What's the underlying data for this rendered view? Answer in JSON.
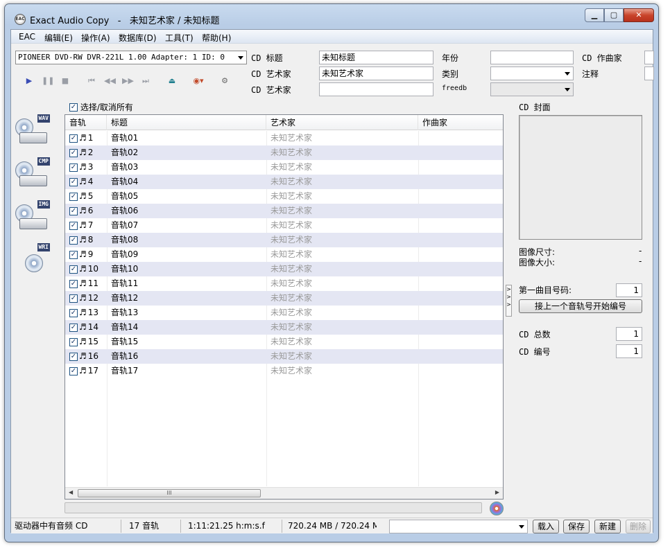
{
  "window": {
    "app_name": "Exact Audio Copy",
    "separator": "-",
    "doc_title": "未知艺术家 / 未知标题"
  },
  "menu": [
    "EAC",
    "编辑(E)",
    "操作(A)",
    "数据库(D)",
    "工具(T)",
    "帮助(H)"
  ],
  "drive": {
    "selected": "PIONEER DVD-RW  DVR-221L 1.00  Adapter: 1  ID: 0"
  },
  "metadata": {
    "cd_title_label": "CD 标题",
    "cd_title_value": "未知标题",
    "cd_artist_label": "CD 艺术家",
    "cd_artist_value": "未知艺术家",
    "cd_artist2_label": "CD 艺术家",
    "cd_artist2_value": "",
    "year_label": "年份",
    "year_value": "",
    "genre_label": "类别",
    "freedb_label": "freedb",
    "composer_label": "CD 作曲家",
    "comment_label": "注释"
  },
  "toolbar": {
    "icons": [
      "play-icon",
      "pause-icon",
      "stop-icon",
      "first-track-icon",
      "rewind-icon",
      "fast-forward-icon",
      "last-track-icon",
      "eject-icon",
      "cd-refresh-icon",
      "network-icon"
    ]
  },
  "select_all_label": "选择/取消所有",
  "side_actions": [
    {
      "name": "copy-wav-button",
      "tag": "WAV"
    },
    {
      "name": "copy-compressed-button",
      "tag": "CMP"
    },
    {
      "name": "copy-image-button",
      "tag": "IMG"
    },
    {
      "name": "write-cd-button",
      "tag": "WRI"
    }
  ],
  "table": {
    "columns": [
      "音轨",
      "标题",
      "艺术家",
      "作曲家"
    ],
    "rows": [
      {
        "track": "1",
        "title": "音轨01",
        "artist": "未知艺术家"
      },
      {
        "track": "2",
        "title": "音轨02",
        "artist": "未知艺术家"
      },
      {
        "track": "3",
        "title": "音轨03",
        "artist": "未知艺术家"
      },
      {
        "track": "4",
        "title": "音轨04",
        "artist": "未知艺术家"
      },
      {
        "track": "5",
        "title": "音轨05",
        "artist": "未知艺术家"
      },
      {
        "track": "6",
        "title": "音轨06",
        "artist": "未知艺术家"
      },
      {
        "track": "7",
        "title": "音轨07",
        "artist": "未知艺术家"
      },
      {
        "track": "8",
        "title": "音轨08",
        "artist": "未知艺术家"
      },
      {
        "track": "9",
        "title": "音轨09",
        "artist": "未知艺术家"
      },
      {
        "track": "10",
        "title": "音轨10",
        "artist": "未知艺术家"
      },
      {
        "track": "11",
        "title": "音轨11",
        "artist": "未知艺术家"
      },
      {
        "track": "12",
        "title": "音轨12",
        "artist": "未知艺术家"
      },
      {
        "track": "13",
        "title": "音轨13",
        "artist": "未知艺术家"
      },
      {
        "track": "14",
        "title": "音轨14",
        "artist": "未知艺术家"
      },
      {
        "track": "15",
        "title": "音轨15",
        "artist": "未知艺术家"
      },
      {
        "track": "16",
        "title": "音轨16",
        "artist": "未知艺术家"
      },
      {
        "track": "17",
        "title": "音轨17",
        "artist": "未知艺术家"
      }
    ],
    "scroll_thumb_glyph": "III"
  },
  "cover": {
    "label": "CD 封面",
    "image_size_label": "图像尺寸:",
    "image_size_value": "-",
    "image_file_label": "图像大小:",
    "image_file_value": "-"
  },
  "numbering": {
    "first_track_label": "第一曲目号码:",
    "first_track_value": "1",
    "continue_button": "接上一个音轨号开始编号",
    "cd_total_label": "CD 总数",
    "cd_total_value": "1",
    "cd_number_label": "CD 编号",
    "cd_number_value": "1"
  },
  "status": {
    "drive_status": "驱动器中有音频 CD",
    "track_count": "17 音轨",
    "duration": "1:11:21.25 h:m:s.f",
    "size": "720.24 MB / 720.24 M",
    "load_button": "载入",
    "save_button": "保存",
    "new_button": "新建",
    "delete_button": "删除"
  },
  "colors": {
    "row_alt": "#e4e6f3",
    "artist_text": "#9a9a9a",
    "close_button": "#c9442b"
  }
}
